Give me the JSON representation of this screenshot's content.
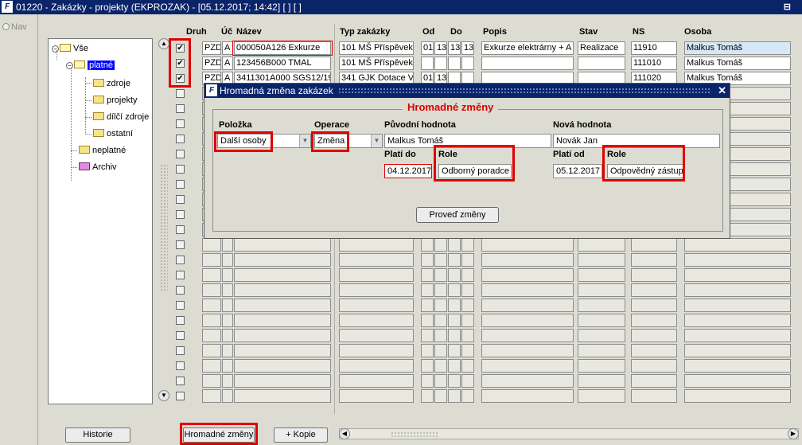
{
  "window": {
    "logo": "F",
    "title": "01220 - Zakázky - projekty (EKPROZAK) - [05.12.2017; 14:42]  [ ]  [ ]",
    "restore_glyph": "⊟"
  },
  "nav": {
    "label": "Nav"
  },
  "tree": {
    "root": "Vše",
    "items": [
      {
        "label": "platné",
        "selected": true
      },
      {
        "label": "zdroje"
      },
      {
        "label": "projekty"
      },
      {
        "label": "dílčí zdroje"
      },
      {
        "label": "ostatní"
      },
      {
        "label": "neplatné"
      },
      {
        "label": "Archiv"
      }
    ]
  },
  "table": {
    "headers": {
      "druh": "Druh",
      "uc": "Úč",
      "nazev": "Název",
      "typ": "Typ zakázky",
      "od": "Od",
      "do": "Do",
      "popis": "Popis",
      "stav": "Stav",
      "ns": "NS",
      "osoba": "Osoba"
    },
    "rows": [
      {
        "checked": true,
        "druh": "PZD",
        "uc": "A",
        "nazev": "000050A126 Exkurze",
        "typ": "101 MŠ Příspěvek",
        "od1": "01",
        "od2": "13",
        "do1": "13",
        "do2": "13",
        "popis": "Exkurze elektrárny + A",
        "stav": "Realizace",
        "ns": "11910",
        "osoba": "Malkus Tomáš"
      },
      {
        "checked": true,
        "druh": "PZD",
        "uc": "A",
        "nazev": "123456B000 TMAL",
        "typ": "101 MŠ Příspěvek",
        "od1": "",
        "od2": "",
        "do1": "",
        "do2": "",
        "popis": "",
        "stav": "",
        "ns": "111010",
        "osoba": "Malkus Tomáš"
      },
      {
        "checked": true,
        "druh": "PZD",
        "uc": "A",
        "nazev": "3411301A000 SGS12/19",
        "typ": "341 GJK Dotace V",
        "od1": "01",
        "od2": "13",
        "do1": "",
        "do2": "",
        "popis": "",
        "stav": "",
        "ns": "111020",
        "osoba": "Malkus Tomáš"
      }
    ],
    "check_glyph": "✔"
  },
  "dialog": {
    "logo": "F",
    "title": "Hromadná změna zakázek",
    "close_glyph": "✕",
    "group_title": "Hromadné změny",
    "labels": {
      "polozka": "Položka",
      "operace": "Operace",
      "puvodni": "Původní hodnota",
      "nova": "Nová hodnota",
      "plati_do": "Platí do",
      "role1": "Role",
      "plati_od": "Platí od",
      "role2": "Role"
    },
    "fields": {
      "polozka": "Další osoby",
      "operace": "Změna",
      "puvodni": "Malkus Tomáš",
      "nova": "Novák Jan",
      "plati_do": "04.12.2017",
      "role1": "Odborný poradce",
      "plati_od": "05.12.2017",
      "role2": "Odpovědný zástup"
    },
    "submit": "Proveď změny",
    "combo_arrow": "▼"
  },
  "bottom": {
    "historie": "Historie",
    "hromadne": "Hromadné změny",
    "kopie": "+ Kopie"
  },
  "scroll": {
    "up": "▲",
    "down": "▼",
    "left": "◀",
    "right": "▶"
  },
  "colors": {
    "titlebar": "#0a246a",
    "highlight": "#e00000",
    "selection": "#0000ff"
  }
}
